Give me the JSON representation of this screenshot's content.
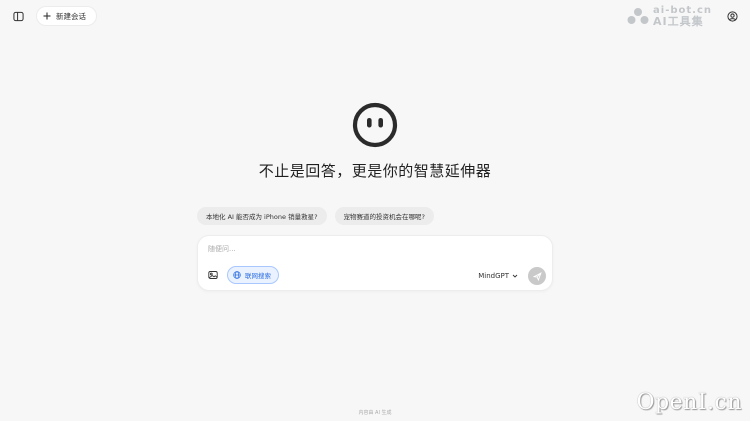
{
  "header": {
    "new_chat_label": "新建会话"
  },
  "watermark_top": {
    "line1": "ai-bot.cn",
    "line2": "AI工具集"
  },
  "hero": {
    "headline": "不止是回答，更是你的智慧延伸器"
  },
  "suggestions": [
    {
      "label": "本地化 AI 能否成为 iPhone 销量救星?"
    },
    {
      "label": "宠物赛道的投资机会在哪呢?"
    }
  ],
  "composer": {
    "placeholder": "随便问...",
    "web_search_label": "联网搜索",
    "model_label": "MindGPT"
  },
  "footer": {
    "note": "内容由 AI 生成"
  },
  "watermark_bottom": {
    "text": "OpenI.cn"
  },
  "colors": {
    "background": "#f7f7f8",
    "accent": "#2f6fe0",
    "send_disabled": "#c9c9c9"
  }
}
